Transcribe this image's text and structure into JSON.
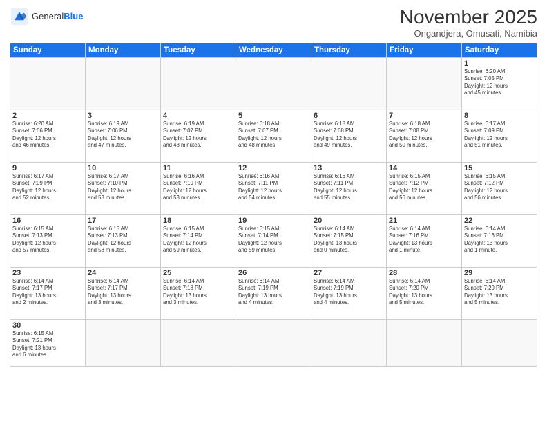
{
  "header": {
    "logo_general": "General",
    "logo_blue": "Blue",
    "month_title": "November 2025",
    "subtitle": "Ongandjera, Omusati, Namibia"
  },
  "days_of_week": [
    "Sunday",
    "Monday",
    "Tuesday",
    "Wednesday",
    "Thursday",
    "Friday",
    "Saturday"
  ],
  "weeks": [
    [
      {
        "day": "",
        "info": ""
      },
      {
        "day": "",
        "info": ""
      },
      {
        "day": "",
        "info": ""
      },
      {
        "day": "",
        "info": ""
      },
      {
        "day": "",
        "info": ""
      },
      {
        "day": "",
        "info": ""
      },
      {
        "day": "1",
        "info": "Sunrise: 6:20 AM\nSunset: 7:05 PM\nDaylight: 12 hours\nand 45 minutes."
      }
    ],
    [
      {
        "day": "2",
        "info": "Sunrise: 6:20 AM\nSunset: 7:06 PM\nDaylight: 12 hours\nand 46 minutes."
      },
      {
        "day": "3",
        "info": "Sunrise: 6:19 AM\nSunset: 7:06 PM\nDaylight: 12 hours\nand 47 minutes."
      },
      {
        "day": "4",
        "info": "Sunrise: 6:19 AM\nSunset: 7:07 PM\nDaylight: 12 hours\nand 48 minutes."
      },
      {
        "day": "5",
        "info": "Sunrise: 6:18 AM\nSunset: 7:07 PM\nDaylight: 12 hours\nand 48 minutes."
      },
      {
        "day": "6",
        "info": "Sunrise: 6:18 AM\nSunset: 7:08 PM\nDaylight: 12 hours\nand 49 minutes."
      },
      {
        "day": "7",
        "info": "Sunrise: 6:18 AM\nSunset: 7:08 PM\nDaylight: 12 hours\nand 50 minutes."
      },
      {
        "day": "8",
        "info": "Sunrise: 6:17 AM\nSunset: 7:09 PM\nDaylight: 12 hours\nand 51 minutes."
      }
    ],
    [
      {
        "day": "9",
        "info": "Sunrise: 6:17 AM\nSunset: 7:09 PM\nDaylight: 12 hours\nand 52 minutes."
      },
      {
        "day": "10",
        "info": "Sunrise: 6:17 AM\nSunset: 7:10 PM\nDaylight: 12 hours\nand 53 minutes."
      },
      {
        "day": "11",
        "info": "Sunrise: 6:16 AM\nSunset: 7:10 PM\nDaylight: 12 hours\nand 53 minutes."
      },
      {
        "day": "12",
        "info": "Sunrise: 6:16 AM\nSunset: 7:11 PM\nDaylight: 12 hours\nand 54 minutes."
      },
      {
        "day": "13",
        "info": "Sunrise: 6:16 AM\nSunset: 7:11 PM\nDaylight: 12 hours\nand 55 minutes."
      },
      {
        "day": "14",
        "info": "Sunrise: 6:15 AM\nSunset: 7:12 PM\nDaylight: 12 hours\nand 56 minutes."
      },
      {
        "day": "15",
        "info": "Sunrise: 6:15 AM\nSunset: 7:12 PM\nDaylight: 12 hours\nand 56 minutes."
      }
    ],
    [
      {
        "day": "16",
        "info": "Sunrise: 6:15 AM\nSunset: 7:13 PM\nDaylight: 12 hours\nand 57 minutes."
      },
      {
        "day": "17",
        "info": "Sunrise: 6:15 AM\nSunset: 7:13 PM\nDaylight: 12 hours\nand 58 minutes."
      },
      {
        "day": "18",
        "info": "Sunrise: 6:15 AM\nSunset: 7:14 PM\nDaylight: 12 hours\nand 59 minutes."
      },
      {
        "day": "19",
        "info": "Sunrise: 6:15 AM\nSunset: 7:14 PM\nDaylight: 12 hours\nand 59 minutes."
      },
      {
        "day": "20",
        "info": "Sunrise: 6:14 AM\nSunset: 7:15 PM\nDaylight: 13 hours\nand 0 minutes."
      },
      {
        "day": "21",
        "info": "Sunrise: 6:14 AM\nSunset: 7:16 PM\nDaylight: 13 hours\nand 1 minute."
      },
      {
        "day": "22",
        "info": "Sunrise: 6:14 AM\nSunset: 7:16 PM\nDaylight: 13 hours\nand 1 minute."
      }
    ],
    [
      {
        "day": "23",
        "info": "Sunrise: 6:14 AM\nSunset: 7:17 PM\nDaylight: 13 hours\nand 2 minutes."
      },
      {
        "day": "24",
        "info": "Sunrise: 6:14 AM\nSunset: 7:17 PM\nDaylight: 13 hours\nand 3 minutes."
      },
      {
        "day": "25",
        "info": "Sunrise: 6:14 AM\nSunset: 7:18 PM\nDaylight: 13 hours\nand 3 minutes."
      },
      {
        "day": "26",
        "info": "Sunrise: 6:14 AM\nSunset: 7:19 PM\nDaylight: 13 hours\nand 4 minutes."
      },
      {
        "day": "27",
        "info": "Sunrise: 6:14 AM\nSunset: 7:19 PM\nDaylight: 13 hours\nand 4 minutes."
      },
      {
        "day": "28",
        "info": "Sunrise: 6:14 AM\nSunset: 7:20 PM\nDaylight: 13 hours\nand 5 minutes."
      },
      {
        "day": "29",
        "info": "Sunrise: 6:14 AM\nSunset: 7:20 PM\nDaylight: 13 hours\nand 5 minutes."
      }
    ],
    [
      {
        "day": "30",
        "info": "Sunrise: 6:15 AM\nSunset: 7:21 PM\nDaylight: 13 hours\nand 6 minutes.",
        "last": true
      },
      {
        "day": "",
        "info": "",
        "last": true
      },
      {
        "day": "",
        "info": "",
        "last": true
      },
      {
        "day": "",
        "info": "",
        "last": true
      },
      {
        "day": "",
        "info": "",
        "last": true
      },
      {
        "day": "",
        "info": "",
        "last": true
      },
      {
        "day": "",
        "info": "",
        "last": true
      }
    ]
  ]
}
